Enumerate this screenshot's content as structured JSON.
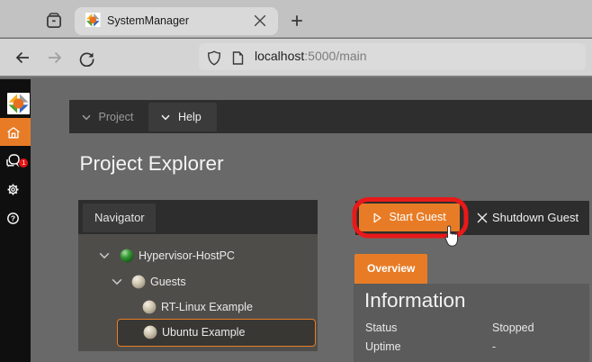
{
  "colors": {
    "accent_orange": "#e87c26",
    "annotation_red": "#e81919"
  },
  "browser": {
    "tab_title": "SystemManager",
    "new_tab_label": "+",
    "url_host": "localhost",
    "url_path": ":5000/main"
  },
  "app_sidebar": {
    "items": [
      {
        "name": "logo",
        "icon": "pinwheel-logo"
      },
      {
        "name": "home",
        "icon": "home-icon",
        "active": true
      },
      {
        "name": "messages",
        "icon": "chat-icon",
        "badge": "1"
      },
      {
        "name": "settings",
        "icon": "gear-icon"
      },
      {
        "name": "help",
        "icon": "question-icon"
      }
    ],
    "badge_value": "1"
  },
  "menubar": {
    "project_label": "Project",
    "help_label": "Help"
  },
  "page": {
    "title": "Project Explorer"
  },
  "navigator": {
    "tab_label": "Navigator",
    "tree": [
      {
        "label": "Hypervisor-HostPC",
        "level": 0,
        "chevron": true,
        "ball": "green",
        "selected": false
      },
      {
        "label": "Guests",
        "level": 1,
        "chevron": true,
        "ball": "tan",
        "selected": false
      },
      {
        "label": "RT-Linux Example",
        "level": 2,
        "chevron": false,
        "ball": "tan",
        "selected": false
      },
      {
        "label": "Ubuntu Example",
        "level": 2,
        "chevron": false,
        "ball": "tan",
        "selected": true
      }
    ]
  },
  "toolbar": {
    "start_label": "Start Guest",
    "shutdown_label": "Shutdown Guest"
  },
  "tabs": {
    "overview_label": "Overview"
  },
  "info": {
    "title": "Information",
    "rows": [
      {
        "label": "Status",
        "value": "Stopped"
      },
      {
        "label": "Uptime",
        "value": "-"
      }
    ]
  }
}
